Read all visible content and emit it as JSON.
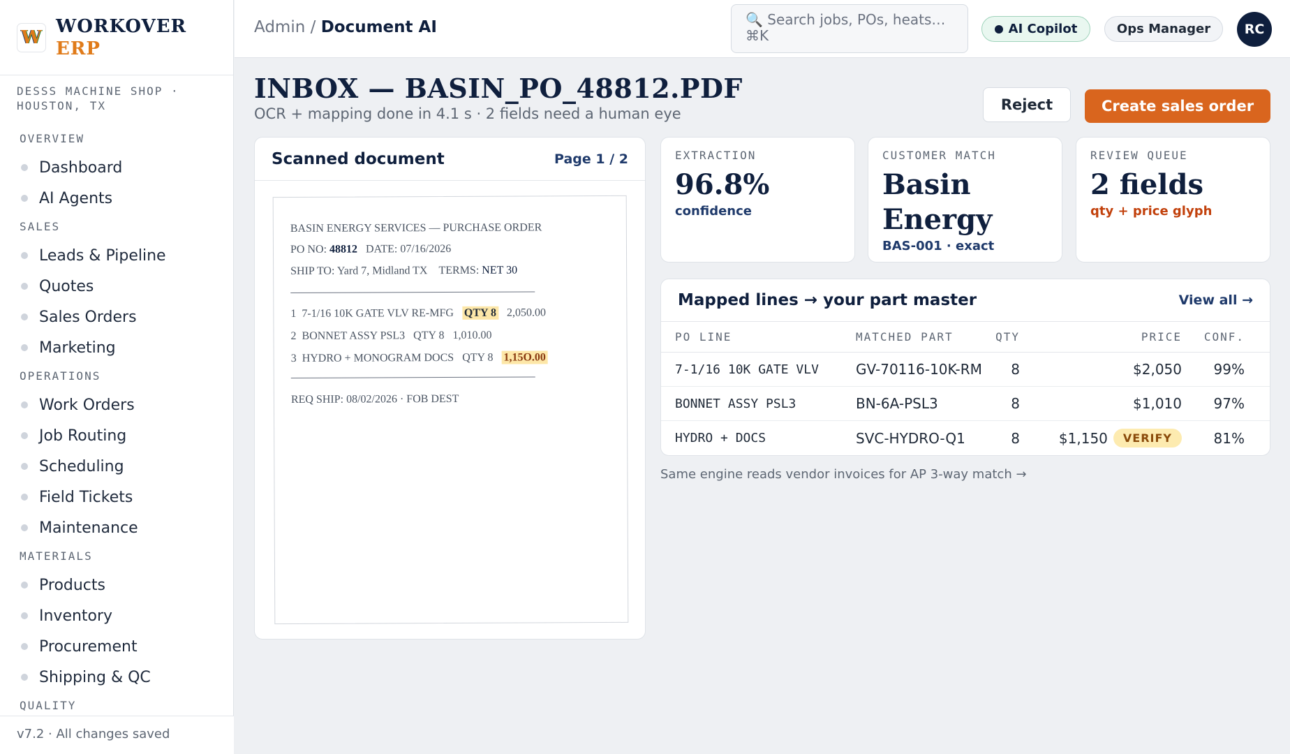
{
  "brand": {
    "logo_letter": "W",
    "name_line1": "WORKOVER",
    "name_line2": "ERP",
    "accent_color": "#e07b1a",
    "navy": "#0f1f3d"
  },
  "shop": {
    "line1": "DESSS MACHINE SHOP ·",
    "line2": "HOUSTON, TX"
  },
  "sidebar": {
    "sections": [
      {
        "title": "OVERVIEW",
        "items": [
          "Dashboard",
          "AI Agents"
        ]
      },
      {
        "title": "SALES",
        "items": [
          "Leads & Pipeline",
          "Quotes",
          "Sales Orders",
          "Marketing"
        ]
      },
      {
        "title": "OPERATIONS",
        "items": [
          "Work Orders",
          "Job Routing",
          "Scheduling",
          "Field Tickets",
          "Maintenance"
        ]
      },
      {
        "title": "MATERIALS",
        "items": [
          "Products",
          "Inventory",
          "Procurement",
          "Shipping & QC"
        ]
      },
      {
        "title": "QUALITY",
        "items": []
      }
    ],
    "footer": "v7.2 · All changes saved"
  },
  "topbar": {
    "breadcrumb_parent": "Admin",
    "breadcrumb_sep": " / ",
    "breadcrumb_current": "Document AI",
    "search_placeholder": "Search jobs, POs, heats…",
    "search_shortcut": "⌘K",
    "search_icon": "magnifier-icon",
    "copilot_label": "AI Copilot",
    "role_label": "Ops Manager",
    "avatar_initials": "RC"
  },
  "page": {
    "title": "INBOX — BASIN_PO_48812.PDF",
    "subtitle": "OCR + mapping done in 4.1 s · 2 fields need a human eye",
    "reject_label": "Reject",
    "create_label": "Create sales order",
    "create_color": "#d9651e"
  },
  "document": {
    "title": "Scanned document",
    "page_label": "Page 1 / 2",
    "header": "BASIN ENERGY SERVICES — PURCHASE ORDER",
    "po_label": "PO NO:",
    "po_value": "48812",
    "date_text": "DATE: 07/16/2026",
    "ship_to": "SHIP TO: Yard 7, Midland TX",
    "terms_label": "TERMS:",
    "terms_value": "NET 30",
    "line1": {
      "num": "1",
      "desc": "7-1/16 10K GATE VLV RE-MFG",
      "qty": "QTY 8",
      "amount": "2,050.00"
    },
    "line2": {
      "num": "2",
      "desc": "BONNET ASSY PSL3",
      "qty": "QTY 8",
      "amount": "1,010.00"
    },
    "line3": {
      "num": "3",
      "desc": "HYDRO + MONOGRAM DOCS",
      "qty": "QTY 8",
      "amount": "1,15O.00"
    },
    "req_ship": "REQ SHIP: 08/02/2026 · FOB DEST"
  },
  "stats": [
    {
      "label": "EXTRACTION",
      "value": "96.8%",
      "sub": "confidence"
    },
    {
      "label": "CUSTOMER MATCH",
      "value": "Basin Energy",
      "sub": "BAS-001 · exact"
    },
    {
      "label": "REVIEW QUEUE",
      "value": "2 fields",
      "sub": "qty + price glyph"
    }
  ],
  "mapped": {
    "title": "Mapped lines → your part master",
    "link": "View all →",
    "columns": [
      "PO LINE",
      "MATCHED PART",
      "QTY",
      "PRICE",
      "CONF."
    ],
    "rows": [
      {
        "po_line": "7-1/16 10K GATE VLV",
        "part": "GV-70116-10K-RM",
        "qty": "8",
        "price": "$2,050",
        "conf": "99%",
        "badge": ""
      },
      {
        "po_line": "BONNET ASSY PSL3",
        "part": "BN-6A-PSL3",
        "qty": "8",
        "price": "$1,010",
        "conf": "97%",
        "badge": ""
      },
      {
        "po_line": "HYDRO + DOCS",
        "part": "SVC-HYDRO-Q1",
        "qty": "8",
        "price": "$1,150",
        "conf": "81%",
        "badge": "VERIFY"
      }
    ],
    "footnote": "Same engine reads vendor invoices for AP 3-way match →"
  }
}
